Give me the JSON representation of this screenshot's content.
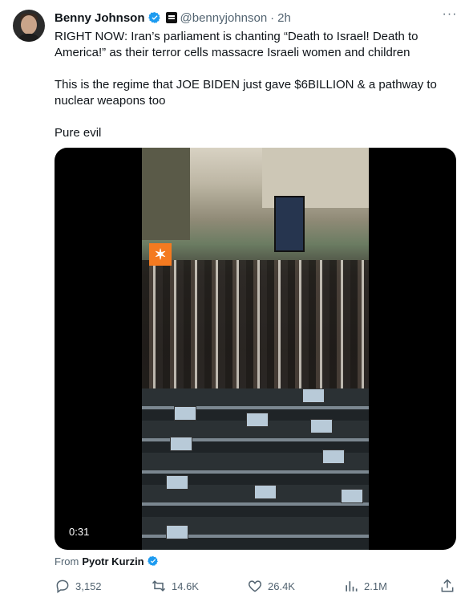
{
  "tweet": {
    "author_name": "Benny Johnson",
    "handle": "@bennyjohnson",
    "separator": "·",
    "time": "2h",
    "more_label": "···",
    "paragraphs": [
      "RIGHT NOW: Iran’s parliament is chanting “Death to Israel! Death to America!” as their terror cells massacre Israeli women and children",
      "This is the regime that JOE BIDEN just gave $6BILLION & a pathway to nuclear weapons too",
      "Pure evil"
    ],
    "video": {
      "duration": "0:31",
      "source_prefix": "From",
      "source_name": "Pyotr Kurzin"
    },
    "stats": {
      "replies": "3,152",
      "reposts": "14.6K",
      "likes": "26.4K",
      "views": "2.1M"
    }
  },
  "colors": {
    "text": "#0f1419",
    "secondary": "#536471",
    "verified": "#1d9bf0",
    "logo_orange": "#f47a20"
  },
  "icons": {
    "reply": "speech-bubble",
    "repost": "repost-arrows",
    "like": "heart-outline",
    "views": "bar-chart",
    "share": "share-arrow-up"
  }
}
